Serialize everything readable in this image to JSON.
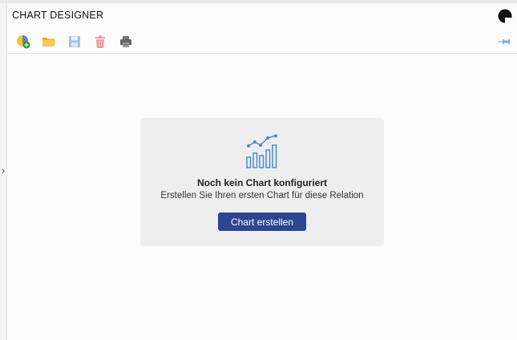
{
  "app": {
    "title": "CHART DESIGNER"
  },
  "toolbar": {
    "buttons": [
      {
        "icon": "new-chart-icon"
      },
      {
        "icon": "open-folder-icon"
      },
      {
        "icon": "save-icon"
      },
      {
        "icon": "delete-icon"
      },
      {
        "icon": "print-icon"
      }
    ],
    "pin_icon": "pin-icon"
  },
  "empty_state": {
    "title": "Noch kein Chart konfiguriert",
    "subtitle": "Erstellen Sie Ihren ersten Chart für diese Relation",
    "button_label": "Chart erstellen"
  },
  "colors": {
    "accent": "#2e4591",
    "icon_blue": "#4a8bd1",
    "card_bg": "#eeeeee"
  }
}
